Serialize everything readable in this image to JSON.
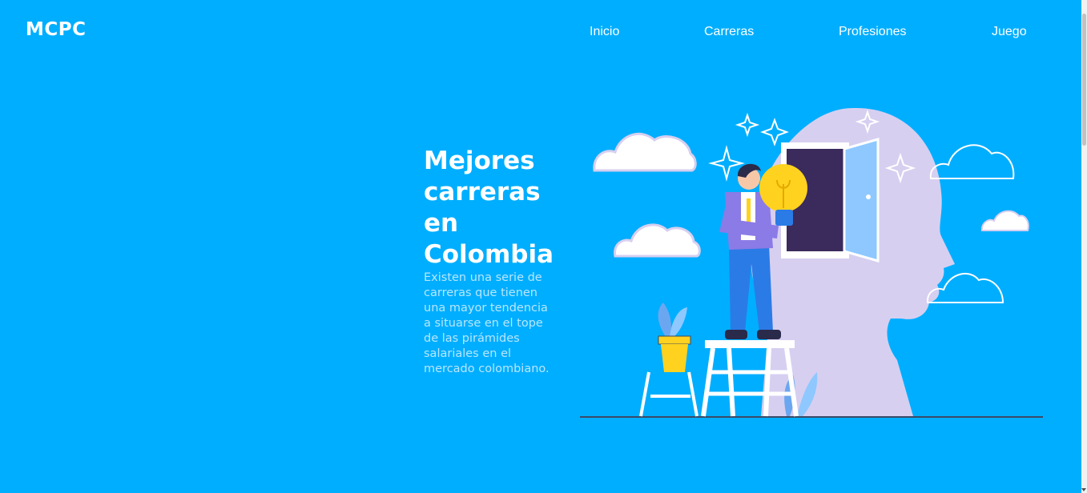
{
  "header": {
    "logo": "MCPC",
    "nav": [
      {
        "label": "Inicio"
      },
      {
        "label": "Carreras"
      },
      {
        "label": "Profesiones"
      },
      {
        "label": "Juego"
      }
    ]
  },
  "hero": {
    "title": "Mejores carreras en Colombia",
    "description": "Existen una serie de carreras que tienen una mayor tendencia a situarse en el tope de las pirámides salariales en el mercado colombiano."
  },
  "colors": {
    "background": "#00aeff",
    "head_silhouette": "#d7cff0",
    "bulb": "#ffd21f",
    "door": "#3b2a5c",
    "door_panel": "#8ec8ff"
  },
  "icons": {
    "illustration": "person-holding-lightbulb-illustration"
  }
}
